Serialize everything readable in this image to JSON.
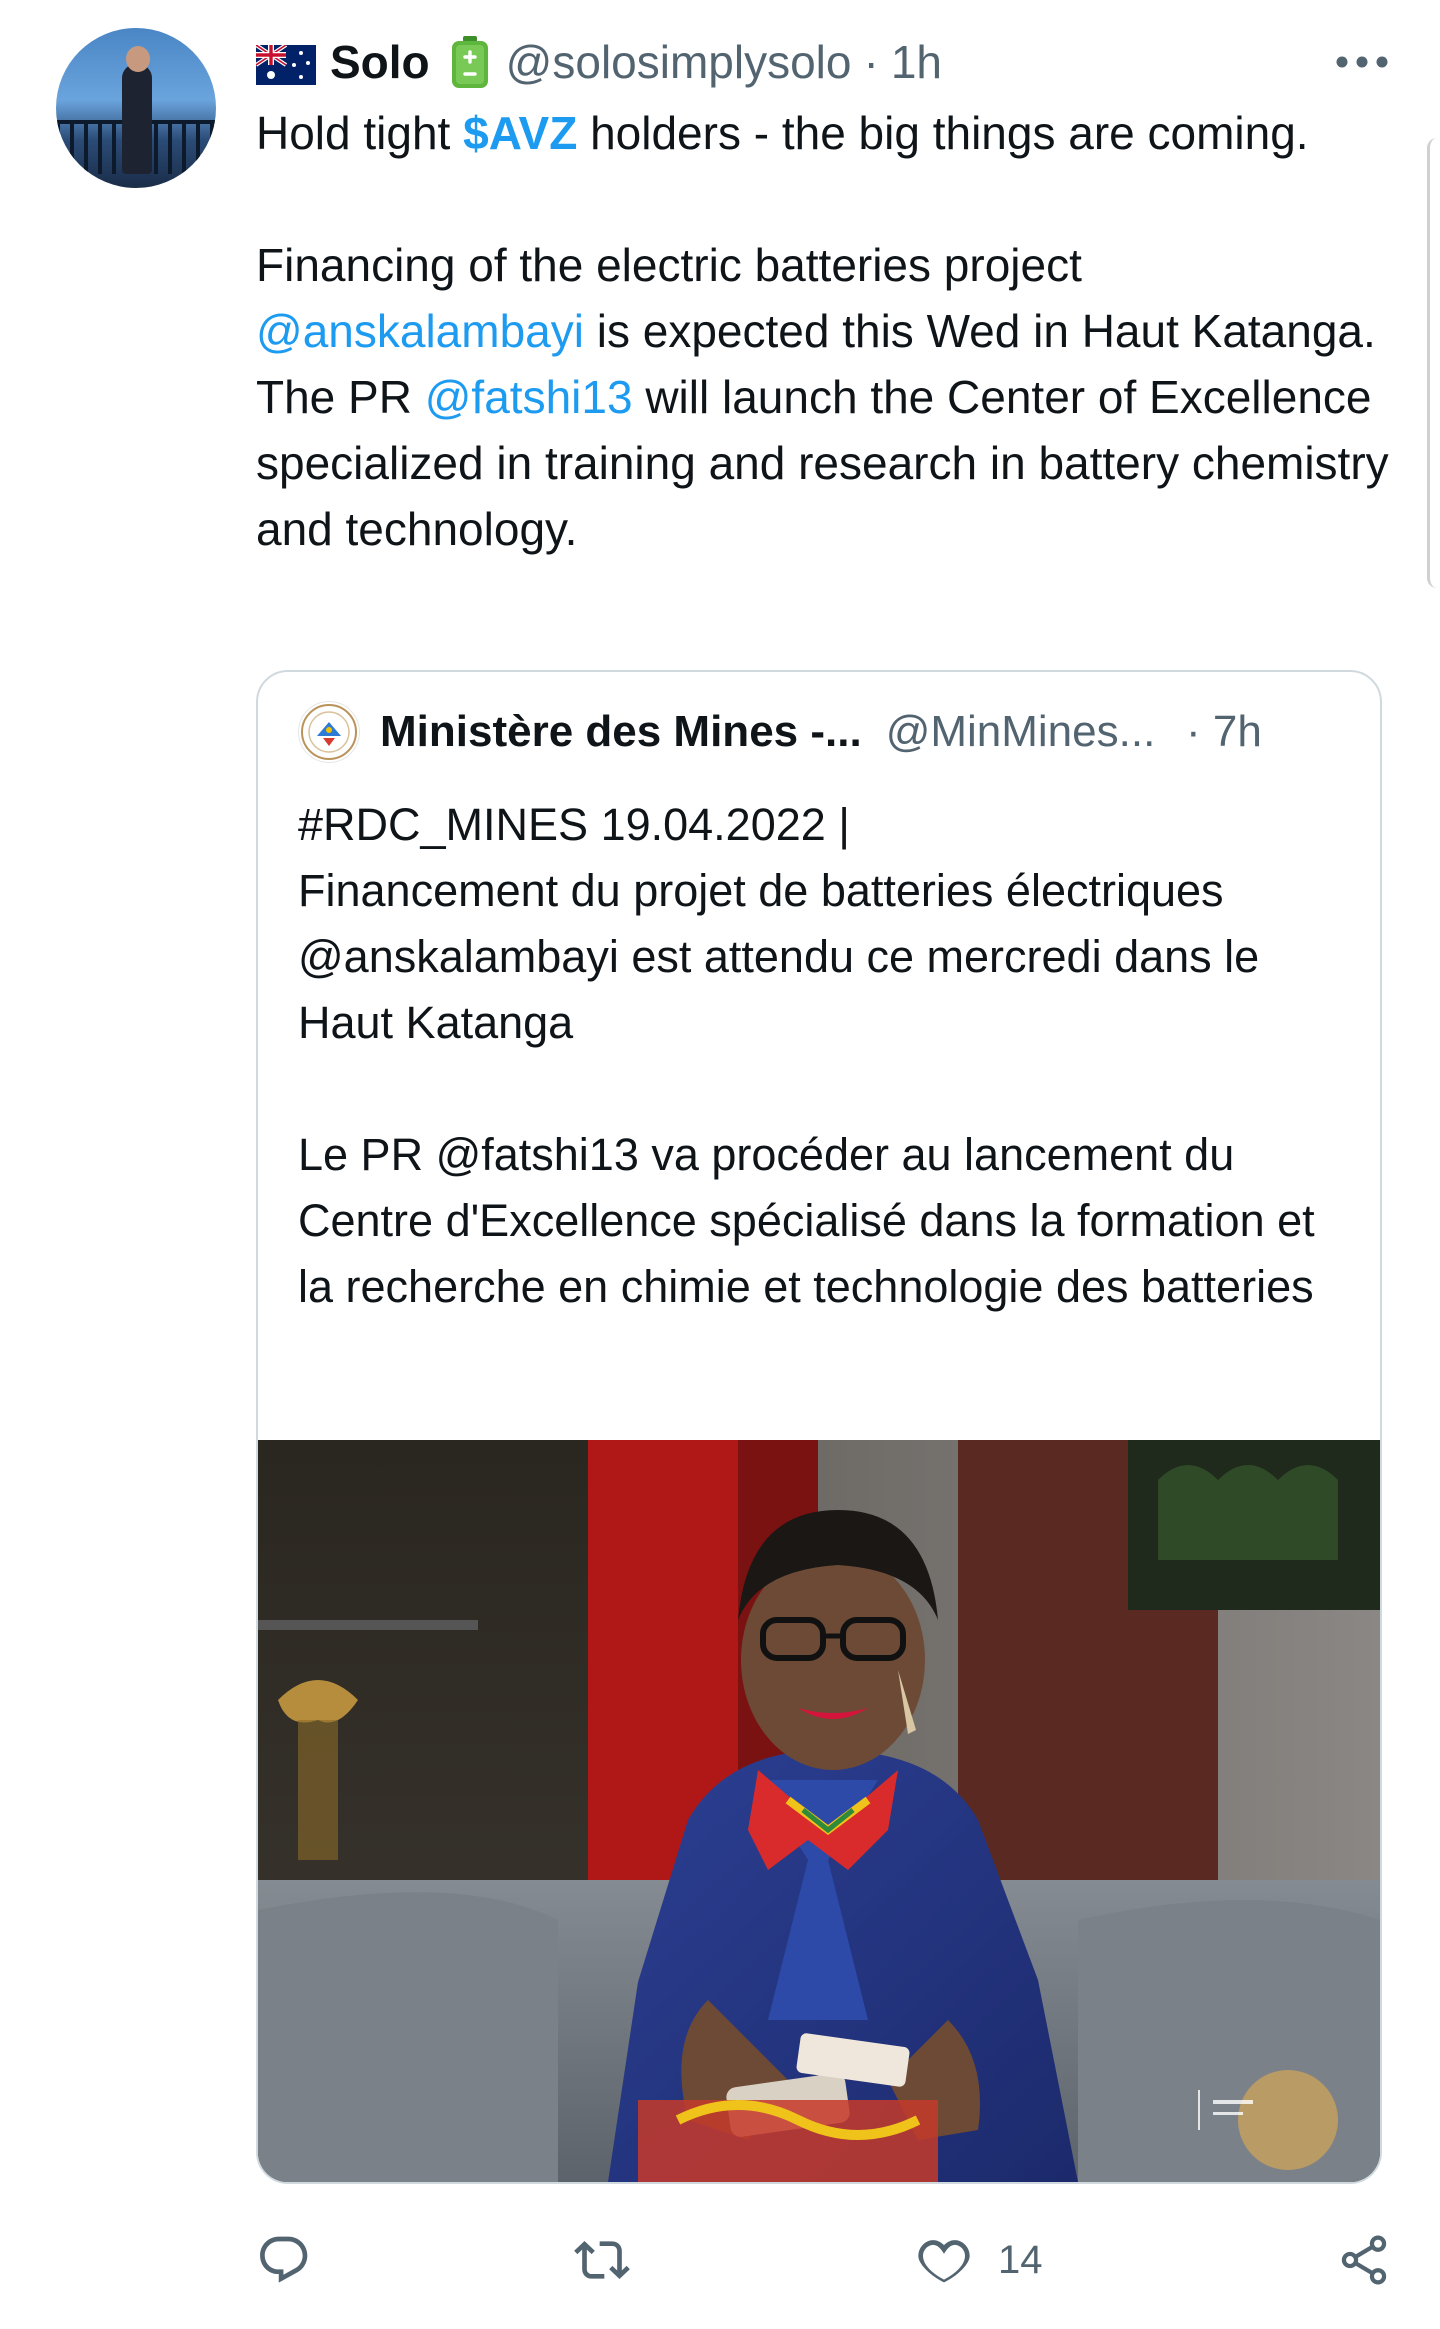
{
  "author": {
    "flag_icon": "australia-flag-icon",
    "display_name": "Solo",
    "badge_icon": "battery-icon",
    "handle": "@solosimplysolo",
    "separator": "·",
    "time": "1h"
  },
  "tweet": {
    "line1_before": "Hold tight ",
    "cashtag": "$AVZ",
    "line1_after": " holders - the big things are coming.",
    "p2_start": "Financing of the electric batteries project ",
    "mention1": "@anskalambayi",
    "p2_mid": " is expected this Wed in Haut Katanga. The PR ",
    "mention2": "@fatshi13",
    "p2_end": " will launch the Center of Excellence specialized in training and research in battery chemistry and technology."
  },
  "quoted": {
    "avatar_icon": "drc-ministry-seal-icon",
    "name": "Ministère des Mines -...",
    "handle": "@MinMines...",
    "time": "· 7h",
    "line1": "#RDC_MINES 19.04.2022 |",
    "line2": "Financement du projet de batteries électriques @anskalambayi est attendu ce mercredi dans le Haut Katanga",
    "para2": "Le PR @fatshi13 va procéder au lancement du Centre d'Excellence spécialisé dans la formation et la recherche en chimie et technologie des batteries"
  },
  "actions": {
    "reply_icon": "reply-icon",
    "retweet_icon": "retweet-icon",
    "like_icon": "heart-icon",
    "like_count": "14",
    "share_icon": "share-icon"
  },
  "colors": {
    "link": "#1d9bf0",
    "secondary_text": "#536471",
    "border": "#cfd9de"
  }
}
